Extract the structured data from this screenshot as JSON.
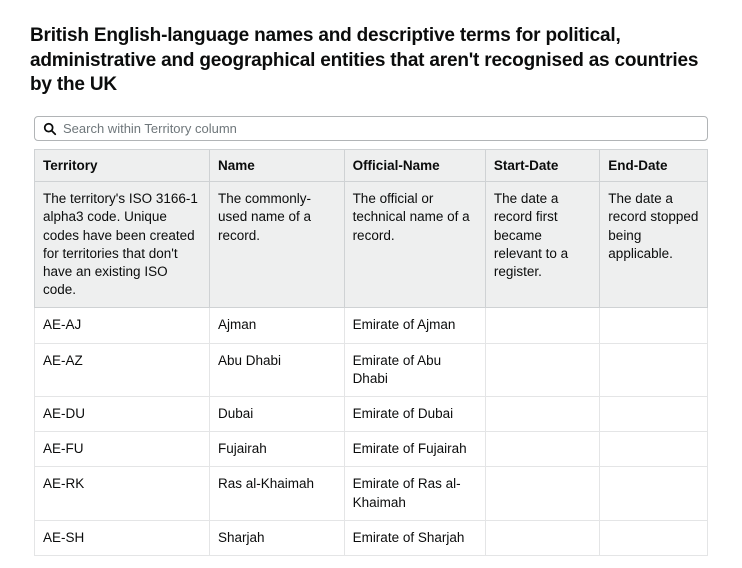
{
  "title": "British English-language names and descriptive terms for political, administrative and geographical entities that aren't recognised as countries by the UK",
  "search": {
    "placeholder": "Search within Territory column"
  },
  "headers": {
    "territory": "Territory",
    "name": "Name",
    "official_name": "Official-Name",
    "start_date": "Start-Date",
    "end_date": "End-Date"
  },
  "descriptions": {
    "territory": "The territory's ISO 3166-1 alpha3 code. Unique codes have been created for territories that don't have an existing ISO code.",
    "name": "The commonly-used name of a record.",
    "official_name": "The official or technical name of a record.",
    "start_date": "The date a record first became relevant to a register.",
    "end_date": "The date a record stopped being applicable."
  },
  "rows": [
    {
      "territory": "AE-AJ",
      "name": "Ajman",
      "official_name": "Emirate of Ajman",
      "start_date": "",
      "end_date": ""
    },
    {
      "territory": "AE-AZ",
      "name": "Abu Dhabi",
      "official_name": "Emirate of Abu Dhabi",
      "start_date": "",
      "end_date": ""
    },
    {
      "territory": "AE-DU",
      "name": "Dubai",
      "official_name": "Emirate of Dubai",
      "start_date": "",
      "end_date": ""
    },
    {
      "territory": "AE-FU",
      "name": "Fujairah",
      "official_name": "Emirate of Fujairah",
      "start_date": "",
      "end_date": ""
    },
    {
      "territory": "AE-RK",
      "name": "Ras al-Khaimah",
      "official_name": "Emirate of Ras al-Khaimah",
      "start_date": "",
      "end_date": ""
    },
    {
      "territory": "AE-SH",
      "name": "Sharjah",
      "official_name": "Emirate of Sharjah",
      "start_date": "",
      "end_date": ""
    }
  ]
}
